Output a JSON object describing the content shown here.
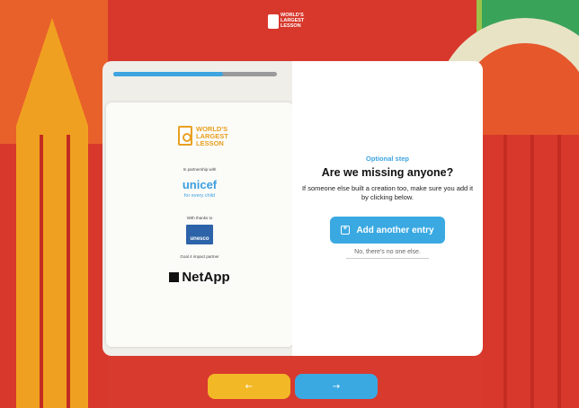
{
  "header": {
    "logo_text": "WORLD'S\nLARGEST\nLESSON"
  },
  "progress": {
    "value": 0.67
  },
  "sponsors": {
    "wll_logo_text": "WORLD'S\nLARGEST\nLESSON",
    "partnership_label": "In partnership with",
    "unicef_name": "unicef",
    "unicef_tagline": "for every child",
    "thanks_label": "With thanks to",
    "unesco_name": "unesco",
    "impact_label": "Goal 4 impact partner",
    "netapp_name": "NetApp"
  },
  "step": {
    "eyebrow": "Optional step",
    "title": "Are we missing anyone?",
    "description": "If someone else built a creation too, make sure you add it by clicking below.",
    "add_button": "Add another entry",
    "skip_link": "No, there's no one else."
  },
  "nav": {
    "prev_label": "←",
    "next_label": "→"
  },
  "colors": {
    "accent_blue": "#3aa9e2",
    "accent_yellow": "#f3b826",
    "background_red": "#d83a2e"
  }
}
